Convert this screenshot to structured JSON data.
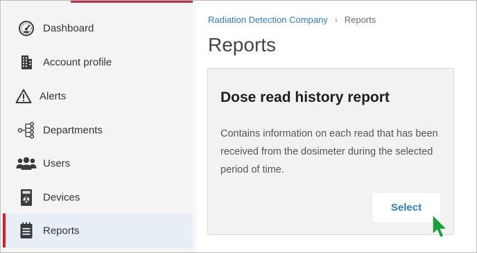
{
  "sidebar": {
    "items": [
      {
        "label": "Dashboard",
        "icon": "dashboard-gauge-icon",
        "active": false
      },
      {
        "label": "Account profile",
        "icon": "building-icon",
        "active": false
      },
      {
        "label": "Alerts",
        "icon": "warning-triangle-icon",
        "active": false
      },
      {
        "label": "Departments",
        "icon": "hierarchy-icon",
        "active": false
      },
      {
        "label": "Users",
        "icon": "users-group-icon",
        "active": false
      },
      {
        "label": "Devices",
        "icon": "dosimeter-device-icon",
        "active": false
      },
      {
        "label": "Reports",
        "icon": "clipboard-list-icon",
        "active": true
      }
    ]
  },
  "breadcrumb": {
    "company": "Radiation Detection Company",
    "separator": "›",
    "current": "Reports"
  },
  "page": {
    "title": "Reports"
  },
  "report_card": {
    "title": "Dose read history report",
    "description": "Contains information on each read that has been received from the dosimeter during the selected period of time.",
    "select_label": "Select"
  },
  "colors": {
    "active_marker": "#d0202e",
    "link_blue": "#2f7cc1",
    "cursor_green": "#1a9e3a"
  }
}
